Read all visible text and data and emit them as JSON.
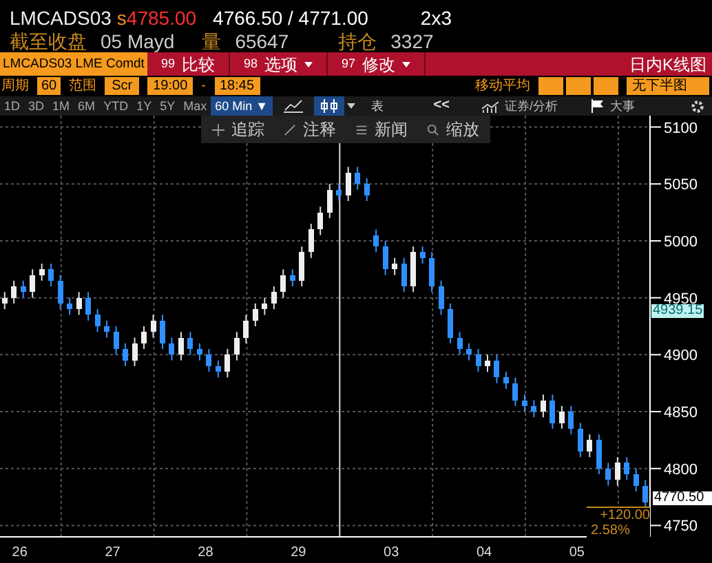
{
  "header": {
    "ticker": "LMCADS03",
    "price_flag": "s",
    "price": "4785.00",
    "bid_ask": "4766.50 / 4771.00",
    "size": "2x3"
  },
  "summary": [
    {
      "label": "截至收盘",
      "value": "05 Mayd"
    },
    {
      "label": "量",
      "value": "65647"
    },
    {
      "label": "持仓",
      "value": "3327"
    }
  ],
  "command_bar": {
    "security": "LMCADS03 LME Comdt",
    "buttons": [
      {
        "code": "99",
        "label": "比较",
        "dropdown": false
      },
      {
        "code": "98",
        "label": "选项",
        "dropdown": true
      },
      {
        "code": "97",
        "label": "修改",
        "dropdown": true
      }
    ],
    "title": "日内K线图"
  },
  "settings": {
    "period_label": "周期",
    "period": "60",
    "range_label": "范围",
    "range": "Scr",
    "start": "19:00",
    "dash": "-",
    "end": "18:45",
    "ma_label": "移动平均",
    "lower_chart": "无下半图"
  },
  "periods": [
    {
      "label": "1D",
      "selected": false
    },
    {
      "label": "3D",
      "selected": false
    },
    {
      "label": "1M",
      "selected": false
    },
    {
      "label": "6M",
      "selected": false
    },
    {
      "label": "YTD",
      "selected": false
    },
    {
      "label": "1Y",
      "selected": false
    },
    {
      "label": "5Y",
      "selected": false
    },
    {
      "label": "Max",
      "selected": false
    },
    {
      "label": "60 Min ▼",
      "selected": true
    }
  ],
  "chart_types": [
    {
      "kind": "line",
      "selected": false
    },
    {
      "kind": "candle",
      "selected": true
    }
  ],
  "table_button": "表",
  "collapse": "<<",
  "analysis": "证券/分析",
  "events": "大事",
  "chart_tools": [
    {
      "kind": "track",
      "label": "追踪"
    },
    {
      "kind": "annotate",
      "label": "注释"
    },
    {
      "kind": "news",
      "label": "新闻"
    },
    {
      "kind": "zoom",
      "label": "缩放"
    }
  ],
  "chart": {
    "day_labels": [
      "26",
      "27",
      "28",
      "29",
      "03",
      "04",
      "05"
    ],
    "markers": {
      "average": "4939.15",
      "last": "4770.50",
      "change": "+120.00",
      "change_pct": "2.58%"
    },
    "chart_data": {
      "type": "candlestick",
      "grid": true,
      "ylim": [
        4740,
        5110
      ],
      "yticks": [
        4750,
        4800,
        4850,
        4900,
        4950,
        5000,
        5050,
        5100
      ],
      "categories": [
        null,
        null,
        null,
        null,
        null,
        null,
        null,
        null,
        null,
        null,
        null,
        null,
        null,
        null,
        null,
        null,
        null,
        null,
        null,
        null,
        null,
        null,
        null,
        null,
        null,
        null,
        null,
        null,
        null,
        null,
        null,
        null,
        null,
        null,
        null,
        null,
        null,
        null,
        null,
        null,
        null,
        null,
        null,
        null,
        null,
        null,
        null,
        null,
        null,
        null,
        null,
        null,
        null,
        null,
        null,
        null,
        null,
        null,
        null,
        null,
        null,
        null,
        null,
        null,
        null,
        null,
        null,
        null,
        null,
        null
      ],
      "ohlc": [
        [
          4945,
          4955,
          4940,
          4950
        ],
        [
          4950,
          4965,
          4945,
          4960
        ],
        [
          4960,
          4965,
          4950,
          4955
        ],
        [
          4955,
          4975,
          4950,
          4970
        ],
        [
          4970,
          4980,
          4965,
          4975
        ],
        [
          4975,
          4980,
          4960,
          4965
        ],
        [
          4965,
          4970,
          4940,
          4945
        ],
        [
          4945,
          4950,
          4935,
          4940
        ],
        [
          4940,
          4955,
          4935,
          4950
        ],
        [
          4950,
          4955,
          4930,
          4935
        ],
        [
          4935,
          4940,
          4920,
          4925
        ],
        [
          4925,
          4930,
          4915,
          4920
        ],
        [
          4920,
          4925,
          4900,
          4905
        ],
        [
          4905,
          4910,
          4890,
          4895
        ],
        [
          4895,
          4915,
          4890,
          4910
        ],
        [
          4910,
          4925,
          4905,
          4920
        ],
        [
          4920,
          4935,
          4915,
          4930
        ],
        [
          4930,
          4935,
          4905,
          4910
        ],
        [
          4910,
          4915,
          4895,
          4900
        ],
        [
          4900,
          4920,
          4895,
          4915
        ],
        [
          4915,
          4920,
          4900,
          4905
        ],
        [
          4905,
          4910,
          4895,
          4900
        ],
        [
          4900,
          4905,
          4885,
          4890
        ],
        [
          4890,
          4895,
          4880,
          4885
        ],
        [
          4885,
          4905,
          4880,
          4900
        ],
        [
          4900,
          4920,
          4895,
          4915
        ],
        [
          4915,
          4935,
          4910,
          4930
        ],
        [
          4930,
          4945,
          4925,
          4940
        ],
        [
          4940,
          4950,
          4935,
          4945
        ],
        [
          4945,
          4960,
          4940,
          4955
        ],
        [
          4955,
          4975,
          4950,
          4970
        ],
        [
          4970,
          4975,
          4960,
          4965
        ],
        [
          4965,
          4995,
          4960,
          4990
        ],
        [
          4990,
          5015,
          4985,
          5010
        ],
        [
          5010,
          5030,
          5005,
          5025
        ],
        [
          5025,
          5050,
          5020,
          5045
        ],
        [
          5045,
          5050,
          5035,
          5040
        ],
        [
          5040,
          5065,
          5035,
          5060
        ],
        [
          5060,
          5065,
          5045,
          5050
        ],
        [
          5050,
          5055,
          5035,
          5040
        ],
        [
          5005,
          5010,
          4990,
          4995
        ],
        [
          4995,
          5000,
          4970,
          4975
        ],
        [
          4975,
          4985,
          4970,
          4980
        ],
        [
          4980,
          4985,
          4955,
          4960
        ],
        [
          4960,
          4995,
          4955,
          4990
        ],
        [
          4990,
          4995,
          4980,
          4985
        ],
        [
          4985,
          4990,
          4955,
          4960
        ],
        [
          4960,
          4965,
          4935,
          4940
        ],
        [
          4940,
          4945,
          4910,
          4915
        ],
        [
          4915,
          4920,
          4900,
          4905
        ],
        [
          4905,
          4910,
          4895,
          4900
        ],
        [
          4900,
          4905,
          4885,
          4890
        ],
        [
          4890,
          4900,
          4885,
          4895
        ],
        [
          4895,
          4900,
          4875,
          4880
        ],
        [
          4880,
          4885,
          4870,
          4875
        ],
        [
          4875,
          4880,
          4855,
          4860
        ],
        [
          4860,
          4865,
          4850,
          4855
        ],
        [
          4855,
          4860,
          4845,
          4850
        ],
        [
          4850,
          4865,
          4845,
          4860
        ],
        [
          4860,
          4865,
          4835,
          4840
        ],
        [
          4840,
          4855,
          4835,
          4850
        ],
        [
          4850,
          4855,
          4830,
          4835
        ],
        [
          4835,
          4840,
          4810,
          4815
        ],
        [
          4815,
          4830,
          4810,
          4825
        ],
        [
          4825,
          4830,
          4795,
          4800
        ],
        [
          4800,
          4805,
          4785,
          4790
        ],
        [
          4790,
          4810,
          4785,
          4805
        ],
        [
          4805,
          4810,
          4790,
          4795
        ],
        [
          4795,
          4800,
          4780,
          4785
        ],
        [
          4785,
          4790,
          4765,
          4770
        ]
      ]
    }
  }
}
